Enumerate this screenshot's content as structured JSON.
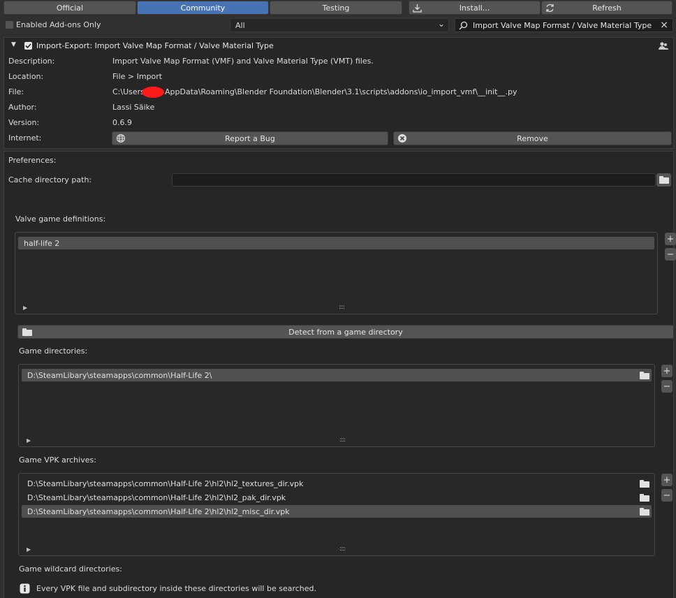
{
  "tabs": [
    {
      "label": "Official",
      "active": false
    },
    {
      "label": "Community",
      "active": true
    },
    {
      "label": "Testing",
      "active": false
    }
  ],
  "install_label": "Install...",
  "refresh_label": "Refresh",
  "filter": {
    "enabled_only_label": "Enabled Add-ons Only",
    "category_value": "All",
    "search_value": "Import Valve Map Format / Valve Material Type"
  },
  "addon": {
    "header": "Import-Export: Import Valve Map Format / Valve Material Type",
    "description_label": "Description:",
    "description": "Import Valve Map Format (VMF) and Valve Material Type (VMT) files.",
    "location_label": "Location:",
    "location": "File > Import",
    "file_label": "File:",
    "file_prefix": "C:\\Users\\",
    "file_suffix": "AppData\\Roaming\\Blender Foundation\\Blender\\3.1\\scripts\\addons\\io_import_vmf\\__init__.py",
    "author_label": "Author:",
    "author": "Lassi Säike",
    "version_label": "Version:",
    "version": "0.6.9",
    "internet_label": "Internet:",
    "report_bug": "Report a Bug",
    "remove": "Remove"
  },
  "prefs": {
    "title": "Preferences:",
    "cache_label": "Cache directory path:",
    "cache_value": "",
    "game_defs_label": "Valve game definitions:",
    "game_defs": [
      "half-life 2"
    ],
    "detect_label": "Detect from a game directory",
    "game_dirs_label": "Game directories:",
    "game_dirs": [
      "D:\\SteamLibary\\steamapps\\common\\Half-Life 2\\"
    ],
    "vpk_label": "Game VPK archives:",
    "vpks": [
      "D:\\SteamLibary\\steamapps\\common\\Half-Life 2\\hl2\\hl2_textures_dir.vpk",
      "D:\\SteamLibary\\steamapps\\common\\Half-Life 2\\hl2\\hl2_pak_dir.vpk",
      "D:\\SteamLibary\\steamapps\\common\\Half-Life 2\\hl2\\hl2_misc_dir.vpk"
    ],
    "wildcard_label": "Game wildcard directories:",
    "wildcard_info": "Every VPK file and subdirectory inside these directories will be searched."
  },
  "icons": {
    "plus": "+",
    "minus": "−",
    "grip": "::::",
    "expand": "▶",
    "collapse": "▼",
    "close": "×",
    "dropdown": "⌄"
  }
}
